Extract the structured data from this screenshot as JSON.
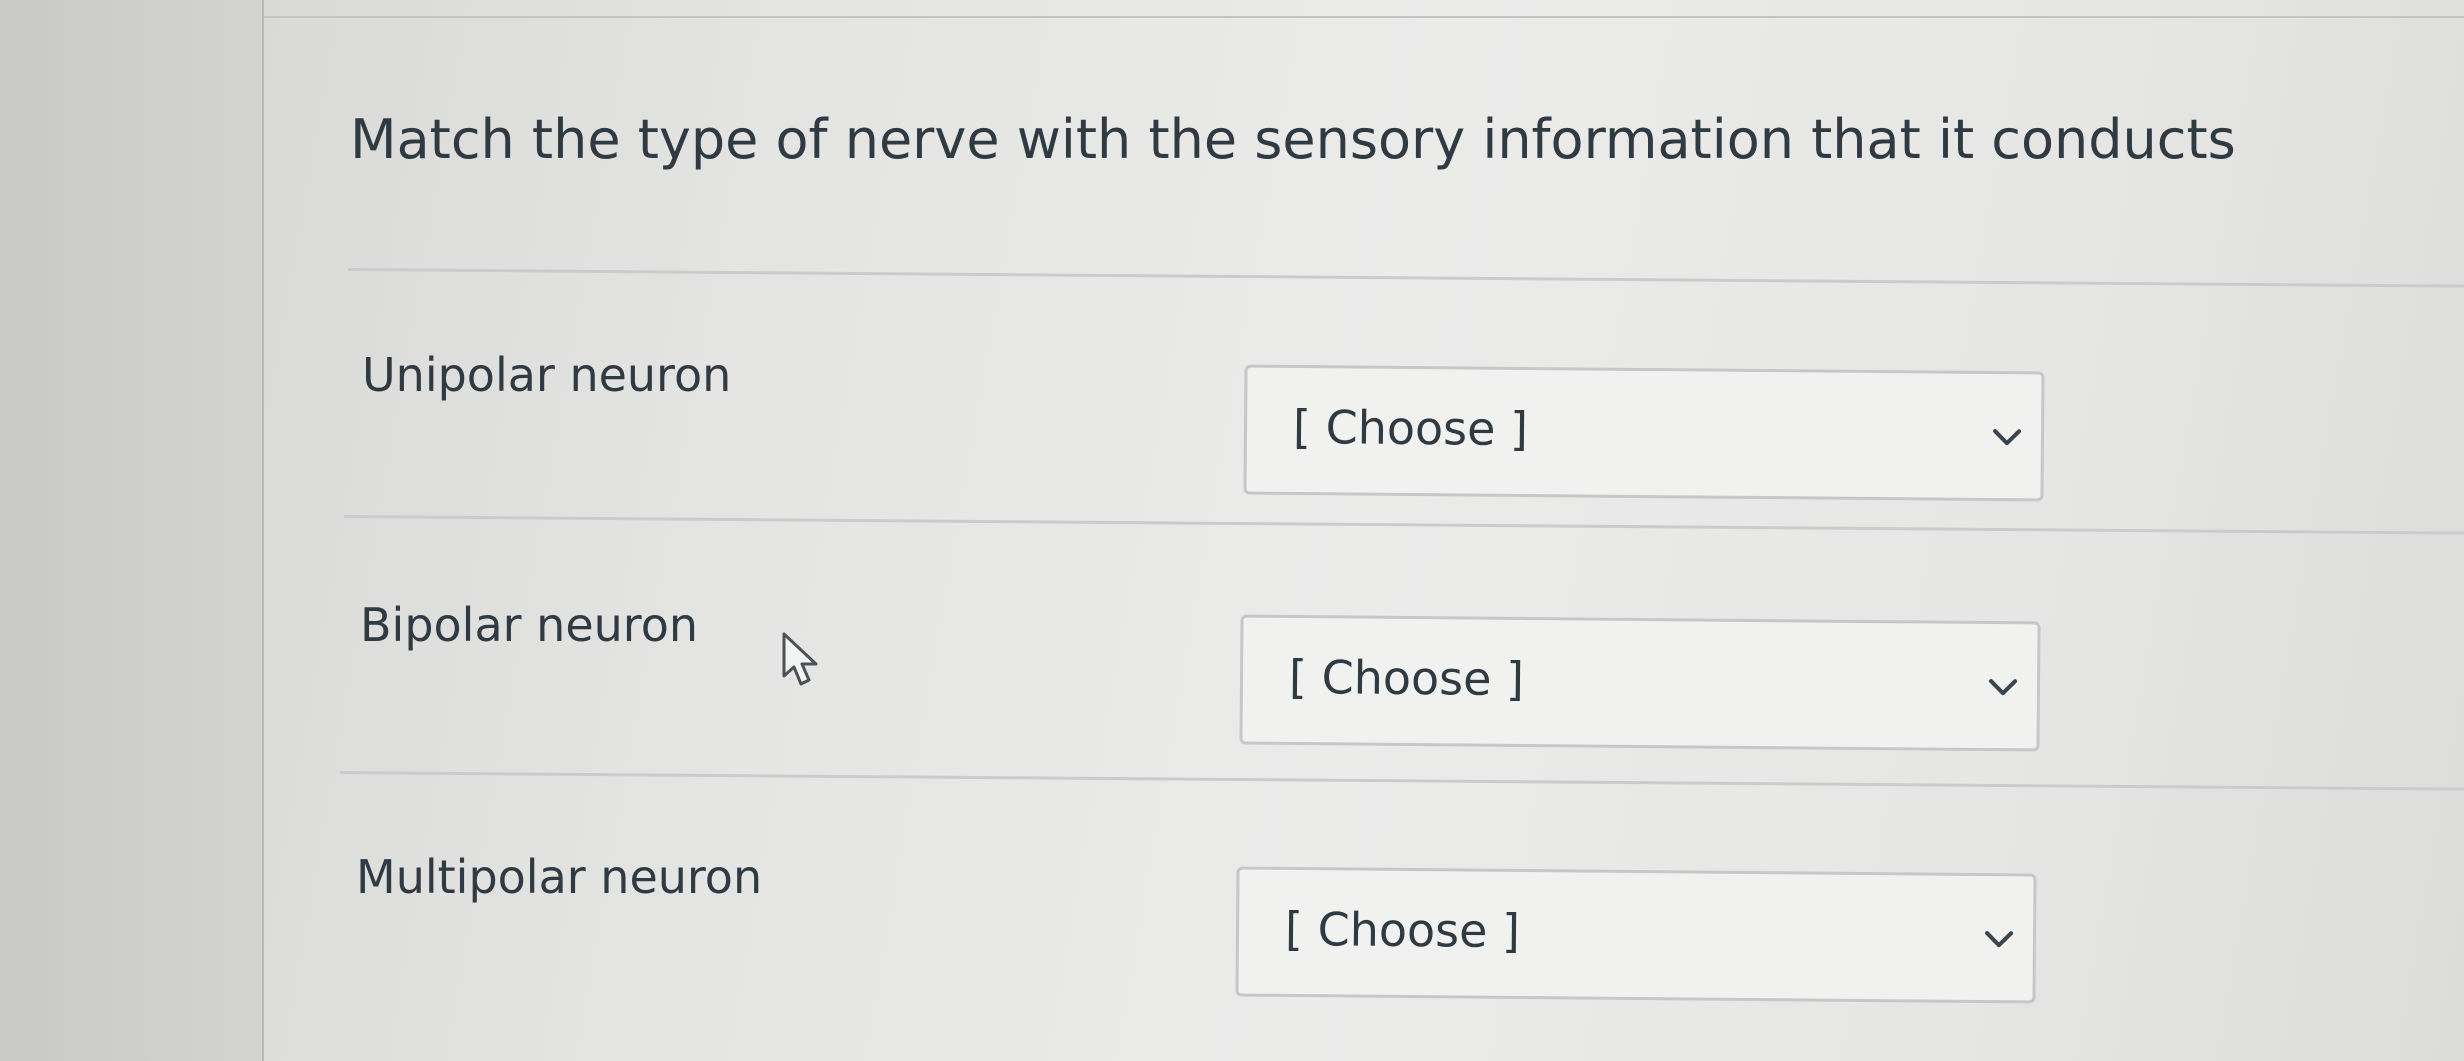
{
  "question": {
    "prompt": "Match the type of nerve with the sensory information that it conducts"
  },
  "rows": [
    {
      "label": "Unipolar neuron",
      "select_value": "[ Choose ]"
    },
    {
      "label": "Bipolar neuron",
      "select_value": "[ Choose ]"
    },
    {
      "label": "Multipolar neuron",
      "select_value": "[ Choose ]"
    }
  ],
  "icons": {
    "dropdown": "chevron-down-icon",
    "pointer": "mouse-cursor-icon"
  },
  "colors": {
    "text": "#2f3a42",
    "select_border": "#c5c8ca",
    "divider": "#c9ccce"
  }
}
